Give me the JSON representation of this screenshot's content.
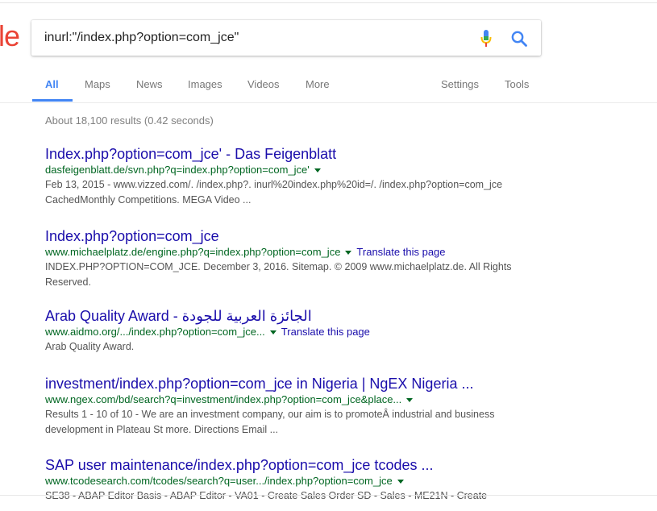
{
  "search": {
    "query": "inurl:\"/index.php?option=com_jce\""
  },
  "logo_fragment": "le",
  "tabs": [
    {
      "label": "All",
      "active": true
    },
    {
      "label": "Maps"
    },
    {
      "label": "News"
    },
    {
      "label": "Images"
    },
    {
      "label": "Videos"
    },
    {
      "label": "More"
    }
  ],
  "tools": {
    "settings": "Settings",
    "tools": "Tools"
  },
  "stats": "About 18,100 results (0.42 seconds)",
  "results": [
    {
      "title": "Index.php?option=com_jce' - Das Feigenblatt",
      "url": "dasfeigenblatt.de/svn.php?q=index.php?option=com_jce'",
      "snippet": "Feb 13, 2015 - www.vizzed.com/. /index.php?. inurl%20index.php%20id=/. /index.php?option=com_jce CachedMonthly Competitions. MEGA Video ..."
    },
    {
      "title": "Index.php?option=com_jce",
      "url": "www.michaelplatz.de/engine.php?q=index.php?option=com_jce",
      "translate": "Translate this page",
      "snippet": "INDEX.PHP?OPTION=COM_JCE. December 3, 2016. Sitemap. © 2009 www.michaelplatz.de. All Rights Reserved."
    },
    {
      "title": "Arab Quality Award - الجائزة العربية للجودة",
      "url": "www.aidmo.org/.../index.php?option=com_jce...",
      "translate": "Translate this page",
      "snippet": "Arab Quality Award."
    },
    {
      "title": "investment/index.php?option=com_jce in Nigeria | NgEX Nigeria ...",
      "url": "www.ngex.com/bd/search?q=investment/index.php?option=com_jce&place...",
      "snippet": "Results 1 - 10 of 10 - We are an investment company, our aim is to promoteÂ industrial and business development in Plateau St more. Directions Email ..."
    },
    {
      "title": "SAP user maintenance/index.php?option=com_jce tcodes ...",
      "url": "www.tcodesearch.com/tcodes/search?q=user.../index.php?option=com_jce",
      "snippet": "SE38 - ABAP Editor Basis - ABAP Editor - VA01 - Create Sales Order SD - Sales - ME21N - Create"
    }
  ],
  "colors": {
    "link": "#1a0dab",
    "url": "#006621",
    "accent": "#4285f4",
    "snippet": "#545454"
  },
  "icons": {
    "mic": "microphone-icon",
    "search": "search-icon",
    "caret": "caret-down-icon"
  }
}
